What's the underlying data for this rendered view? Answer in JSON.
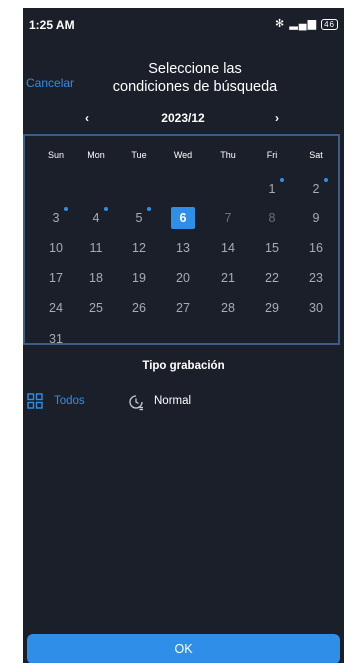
{
  "status_bar": {
    "time": "1:25 AM",
    "battery": "46"
  },
  "header": {
    "cancel_label": "Cancelar",
    "title_line1": "Seleccione las",
    "title_line2": "condiciones de búsqueda"
  },
  "calendar": {
    "month_label": "2023/12",
    "prev_label": "‹",
    "next_label": "›",
    "weekdays": [
      "Sun",
      "Mon",
      "Tue",
      "Wed",
      "Thu",
      "Fri",
      "Sat"
    ],
    "weeks": [
      [
        "",
        "",
        "",
        "",
        "",
        "1",
        "2"
      ],
      [
        "3",
        "4",
        "5",
        "6",
        "7",
        "8",
        "9"
      ],
      [
        "10",
        "11",
        "12",
        "13",
        "14",
        "15",
        "16"
      ],
      [
        "17",
        "18",
        "19",
        "20",
        "21",
        "22",
        "23"
      ],
      [
        "24",
        "25",
        "26",
        "27",
        "28",
        "29",
        "30"
      ],
      [
        "31",
        "",
        "",
        "",
        "",
        "",
        ""
      ]
    ],
    "selected_day": "6",
    "days_with_recordings": [
      "1",
      "2",
      "3",
      "4",
      "5"
    ],
    "future_day_color": "#6a6f7a",
    "accent": "#2f8fe8"
  },
  "recording_type": {
    "title": "Tipo grabación",
    "options": [
      {
        "label": "Todos",
        "icon": "grid-icon",
        "selected": true
      },
      {
        "label": "Normal",
        "icon": "clock-icon",
        "selected": false
      }
    ]
  },
  "ok_label": "OK"
}
